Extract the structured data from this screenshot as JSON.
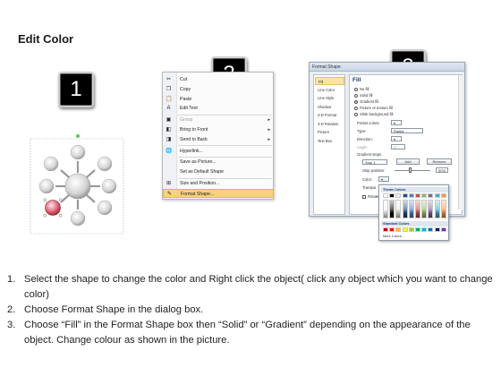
{
  "title": "Edit Color",
  "badges": [
    "1",
    "2",
    "3"
  ],
  "context_menu": {
    "items": [
      {
        "label": "Cut",
        "icon": "scissors-icon",
        "glyph": "✂",
        "underline": "t"
      },
      {
        "label": "Copy",
        "icon": "copy-icon",
        "glyph": "❐"
      },
      {
        "label": "Paste",
        "icon": "paste-icon",
        "glyph": "📋"
      },
      {
        "label": "Edit Text",
        "icon": "edit-text-icon",
        "glyph": "A"
      },
      {
        "label": "Group",
        "icon": "group-icon",
        "glyph": "▣",
        "disabled": true,
        "submenu": true
      },
      {
        "label": "Bring to Front",
        "icon": "bring-front-icon",
        "glyph": "◧",
        "submenu": true
      },
      {
        "label": "Send to Back",
        "icon": "send-back-icon",
        "glyph": "◨",
        "submenu": true
      },
      {
        "label": "Hyperlink...",
        "icon": "hyperlink-icon",
        "glyph": "🌐"
      },
      {
        "label": "Save as Picture...",
        "icon": "",
        "glyph": ""
      },
      {
        "label": "Set as Default Shape",
        "icon": "",
        "glyph": ""
      },
      {
        "label": "Size and Position...",
        "icon": "size-icon",
        "glyph": "⊞"
      },
      {
        "label": "Format Shape...",
        "icon": "format-shape-icon",
        "glyph": "✎",
        "selected": true
      }
    ]
  },
  "dialog": {
    "title": "Format Shape",
    "nav": [
      "Fill",
      "Line Color",
      "Line Style",
      "Shadow",
      "3-D Format",
      "3-D Rotation",
      "Picture",
      "Text Box"
    ],
    "section": "Fill",
    "fill_options": [
      "No fill",
      "Solid fill",
      "Gradient fill",
      "Picture or texture fill",
      "Slide background fill"
    ],
    "selected_option": "Gradient fill",
    "preset_colors_label": "Preset colors:",
    "type_label": "Type:",
    "type_value": "Radial",
    "direction_label": "Direction:",
    "angle_label": "Angle:",
    "angle_value": "0°",
    "gradient_stops_label": "Gradient stops",
    "stop_value": "Stop 1",
    "add_label": "Add",
    "remove_label": "Remove",
    "stop_position_label": "Stop position:",
    "stop_position_value": "50%",
    "color_label": "Color:",
    "transparency_label": "Transpa",
    "rotate_label": "Rotate"
  },
  "picker": {
    "theme_label": "Theme Colors",
    "standard_label": "Standard Colors",
    "more_label": "More Colors...",
    "theme_top": [
      "#ffffff",
      "#000000",
      "#eeece1",
      "#1f497d",
      "#4f81bd",
      "#c0504d",
      "#9bbb59",
      "#8064a2",
      "#4bacc6",
      "#f79646"
    ],
    "standard": [
      "#c00000",
      "#ff0000",
      "#ffc000",
      "#ffff00",
      "#92d050",
      "#00b050",
      "#00b0f0",
      "#0070c0",
      "#002060",
      "#7030a0"
    ]
  },
  "instructions": [
    {
      "num": "1.",
      "text": "Select the shape to change the color and Right click the object( click any object which you want to change color)"
    },
    {
      "num": "2.",
      "text": "Choose Format Shape in the dialog box."
    },
    {
      "num": "3.",
      "text": "Choose “Fill” in the Format Shape box then “Solid” or “Gradient” depending on the appearance of the object. Change colour as shown in the picture."
    }
  ]
}
